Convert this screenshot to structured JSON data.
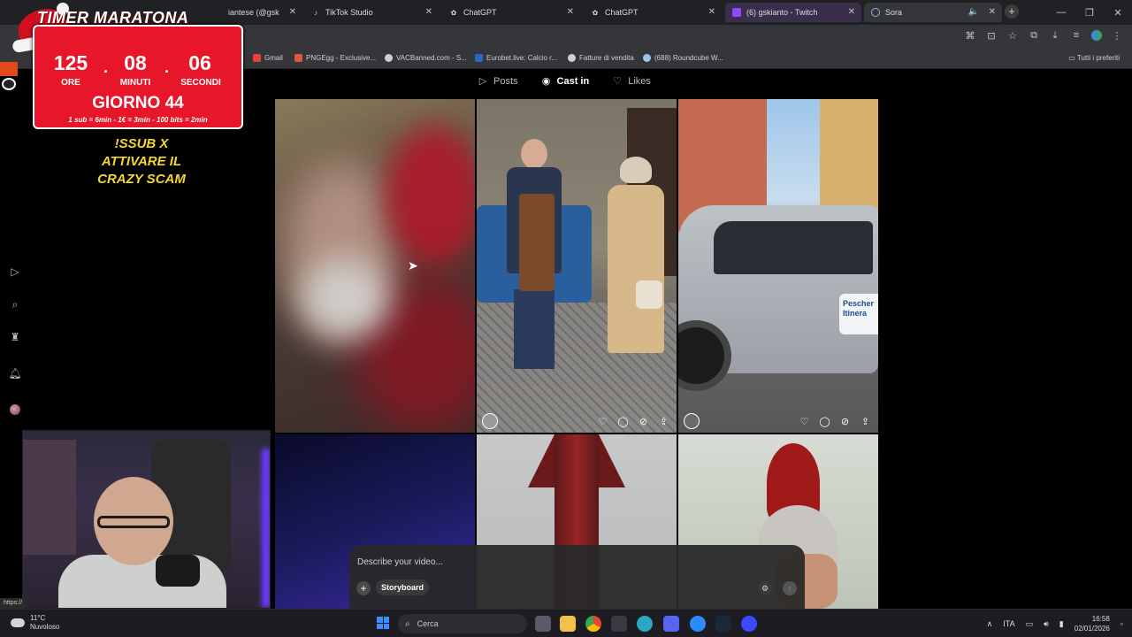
{
  "browser": {
    "tabs": [
      {
        "label": "iantese (@gsk",
        "icon": "tiktok-icon"
      },
      {
        "label": "TikTok Studio",
        "icon": "tiktok-icon"
      },
      {
        "label": "ChatGPT",
        "icon": "chatgpt-icon"
      },
      {
        "label": "ChatGPT",
        "icon": "chatgpt-icon"
      },
      {
        "label": "(6) gskianto - Twitch",
        "icon": "twitch-icon"
      },
      {
        "label": "Sora",
        "icon": "sora-icon"
      }
    ],
    "bookmarks": [
      {
        "label": "Gmail",
        "color": "#ea4335"
      },
      {
        "label": "PNGEgg - Exclusive...",
        "color": "#e2563a"
      },
      {
        "label": "VACBanned.com - S...",
        "color": "#cfcfcf"
      },
      {
        "label": "Eurobet.live: Calcio r...",
        "color": "#2a66c8"
      },
      {
        "label": "Fatture di vendita",
        "color": "#cfcfcf"
      },
      {
        "label": "(688) Roundcube W...",
        "color": "#9ec4ea"
      }
    ],
    "bookmarks_all": "Tutti i preferiti",
    "status_url": "https://"
  },
  "profile": {
    "tabs": [
      {
        "label": "Posts",
        "icon": "posts-icon",
        "active": false
      },
      {
        "label": "Cast in",
        "icon": "cast-in-icon",
        "active": true
      },
      {
        "label": "Likes",
        "icon": "heart-icon",
        "active": false
      }
    ]
  },
  "prompt": {
    "placeholder": "Describe your video...",
    "storyboard_label": "Storyboard"
  },
  "overlay": {
    "title": "TIMER MARATONA",
    "hours": "125",
    "minutes": "08",
    "seconds": "06",
    "hours_label": "ORE",
    "minutes_label": "MINUTI",
    "seconds_label": "SECONDI",
    "day": "GIORNO 44",
    "rates": "1 sub = 6min - 1€ = 3min - 100 bits = 2min",
    "sub_msg_1": "!SSUB X",
    "sub_msg_2": "ATTIVARE IL",
    "sub_msg_3": "CRAZY SCAM"
  },
  "tiles": {
    "sign_line1": "Pescher",
    "sign_line2": "Itinera"
  },
  "taskbar": {
    "weather_temp": "11°C",
    "weather_desc": "Nuvoloso",
    "search_label": "Cerca",
    "language": "ITA",
    "time": "16:58",
    "date": "02/01/2026"
  }
}
